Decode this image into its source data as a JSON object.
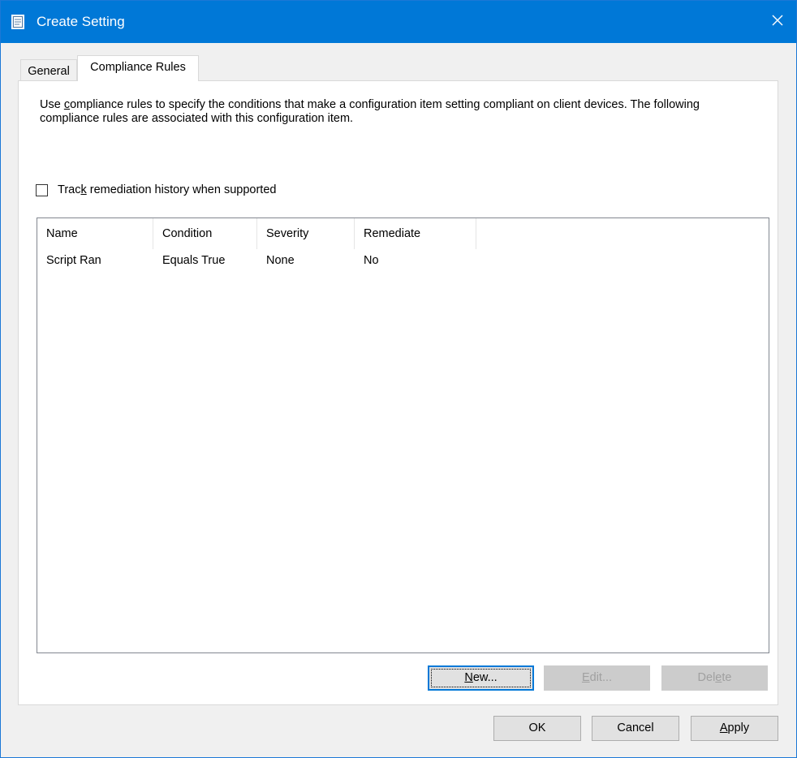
{
  "window": {
    "title": "Create Setting",
    "accent_color": "#0078d7",
    "icon": "window-app-icon",
    "close_icon": "close-icon"
  },
  "tabs": [
    {
      "label": "General",
      "selected": false
    },
    {
      "label": "Compliance Rules",
      "selected": true
    }
  ],
  "compliance": {
    "description": "Use compliance rules to specify the conditions that make a configuration item setting compliant on client devices. The following compliance rules are associated with this configuration item.",
    "description_prefix": "Use ",
    "description_accel": "c",
    "description_rest": "ompliance rules to specify the conditions that make a configuration item setting compliant on client devices. The following compliance rules are associated with this configuration item.",
    "track_checkbox": {
      "label": "Track remediation history when supported",
      "label_prefix": "Trac",
      "label_accel": "k",
      "label_rest": " remediation history when supported",
      "checked": false
    },
    "columns": [
      "Name",
      "Condition",
      "Severity",
      "Remediate"
    ],
    "rows": [
      [
        "Script Ran",
        "Equals True",
        "None",
        "No"
      ]
    ],
    "buttons": {
      "new": {
        "label": "New...",
        "accel": "N",
        "rest": "ew...",
        "enabled": true
      },
      "edit": {
        "label": "Edit...",
        "accel": "E",
        "rest": "dit...",
        "enabled": false
      },
      "delete": {
        "label": "Delete",
        "prefix": "Del",
        "accel": "e",
        "rest": "te",
        "enabled": false
      }
    }
  },
  "dialog_buttons": {
    "ok": "OK",
    "cancel": "Cancel",
    "apply": "Apply",
    "apply_accel": "A",
    "apply_rest": "pply"
  }
}
